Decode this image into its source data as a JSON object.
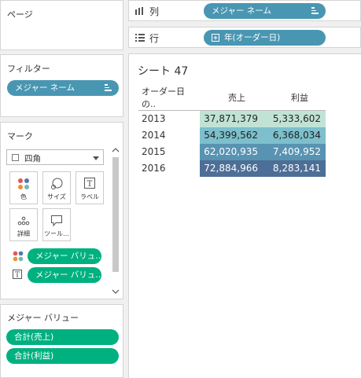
{
  "pages_panel": {
    "title": "ページ"
  },
  "columns_shelf": {
    "label": "列",
    "pill": "メジャー ネーム"
  },
  "rows_shelf": {
    "label": "行",
    "pill": "年(オーダー日)"
  },
  "filters_panel": {
    "title": "フィルター",
    "pill": "メジャー ネーム"
  },
  "marks_panel": {
    "title": "マーク",
    "mark_type": "四角",
    "buttons": [
      {
        "label": "色",
        "icon": "color-icon"
      },
      {
        "label": "サイズ",
        "icon": "size-icon"
      },
      {
        "label": "ラベル",
        "icon": "label-icon"
      },
      {
        "label": "詳細",
        "icon": "detail-icon"
      },
      {
        "label": "ツール…",
        "icon": "tooltip-icon"
      }
    ],
    "encodings": [
      {
        "icon": "color-icon",
        "pill": "メジャー バリュ…"
      },
      {
        "icon": "label-icon",
        "pill": "メジャー バリュ…"
      }
    ]
  },
  "measure_values_panel": {
    "title": "メジャー バリュー",
    "pills": [
      "合計(売上)",
      "合計(利益)"
    ]
  },
  "sheet": {
    "title": "シート 47",
    "headers": [
      "オーダー日 の..",
      "売上",
      "利益"
    ],
    "rows": [
      {
        "year": "2013",
        "sales": "37,871,379",
        "profit": "5,333,602",
        "color": "#c1e3d6"
      },
      {
        "year": "2014",
        "sales": "54,399,562",
        "profit": "6,368,034",
        "color": "#7dbfcc"
      },
      {
        "year": "2015",
        "sales": "62,020,935",
        "profit": "7,409,952",
        "color": "#5893b2"
      },
      {
        "year": "2016",
        "sales": "72,884,966",
        "profit": "8,283,141",
        "color": "#4d6e96"
      }
    ]
  },
  "colors": {
    "blue_pill": "#4996b2",
    "green_pill": "#00b180"
  }
}
